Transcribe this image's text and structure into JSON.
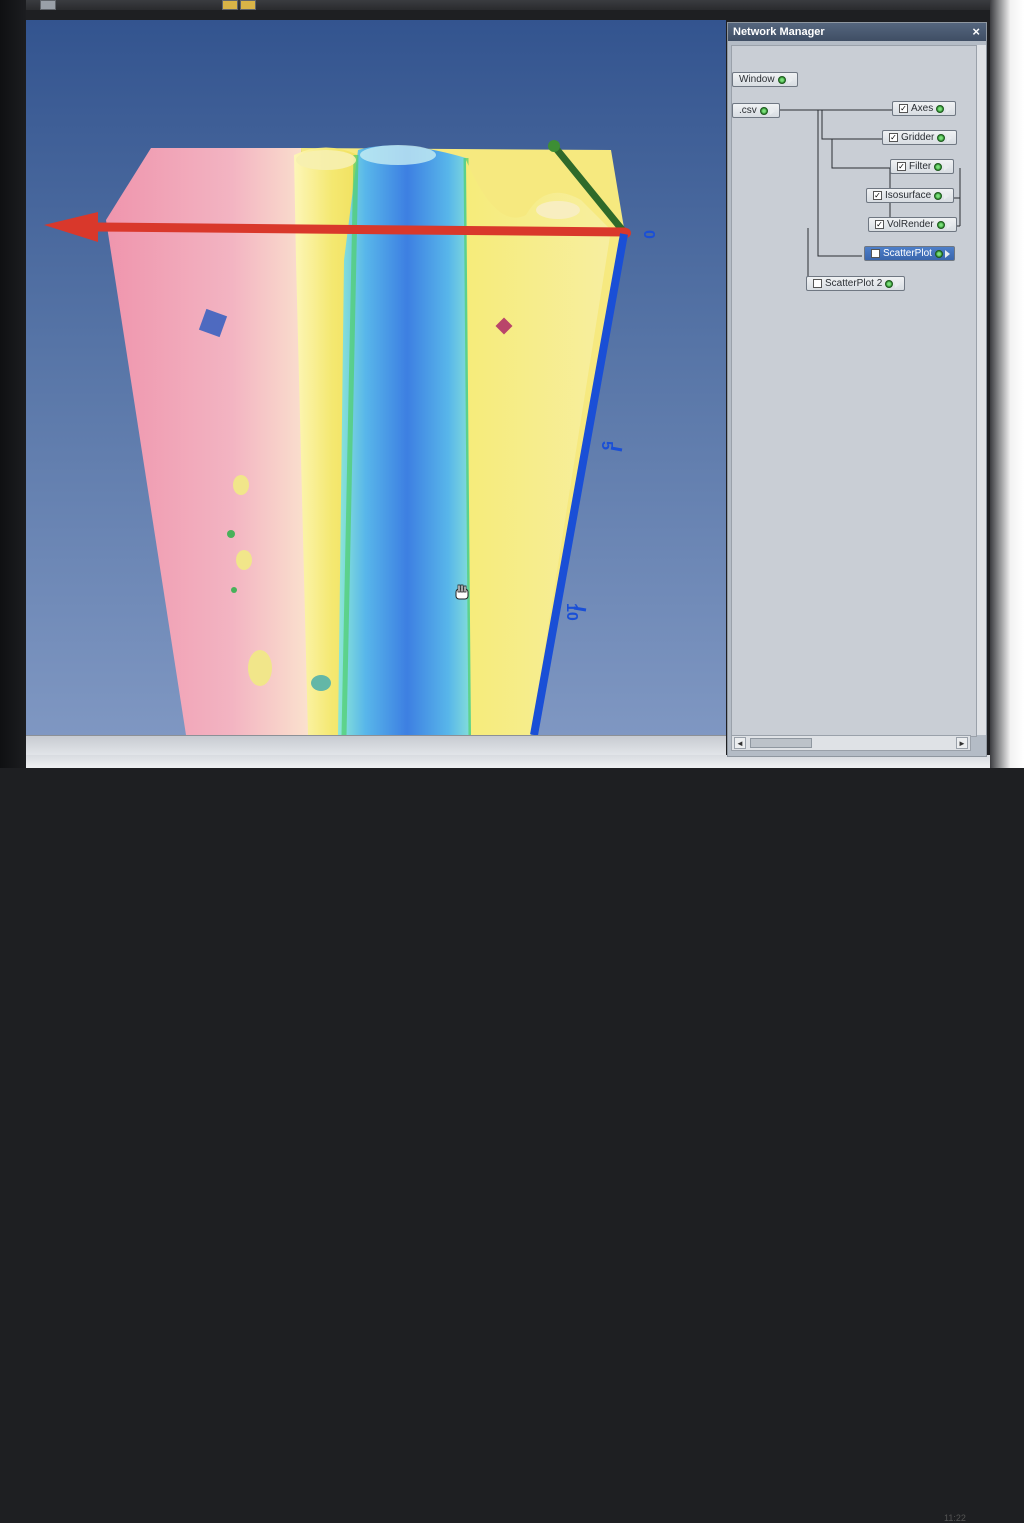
{
  "panel": {
    "title": "Network Manager",
    "close_glyph": "×",
    "modules": [
      {
        "id": "window",
        "label": "Window",
        "checkbox": false,
        "selected": false
      },
      {
        "id": "csv",
        "label": ".csv",
        "checkbox": false,
        "selected": false
      },
      {
        "id": "axes",
        "label": "Axes",
        "checkbox": true,
        "checked": true,
        "selected": false
      },
      {
        "id": "gridder",
        "label": "Gridder",
        "checkbox": true,
        "checked": true,
        "selected": false
      },
      {
        "id": "filter",
        "label": "Filter",
        "checkbox": true,
        "checked": true,
        "selected": false
      },
      {
        "id": "isosurface",
        "label": "Isosurface",
        "checkbox": true,
        "checked": true,
        "selected": false
      },
      {
        "id": "volrender",
        "label": "VolRender",
        "checkbox": true,
        "checked": true,
        "selected": false
      },
      {
        "id": "scatterplot",
        "label": "ScatterPlot",
        "checkbox": true,
        "checked": false,
        "selected": true
      },
      {
        "id": "scatterplot2",
        "label": "ScatterPlot 2",
        "checkbox": true,
        "checked": false,
        "selected": false
      }
    ],
    "check_glyph": "✓"
  },
  "viewport": {
    "axis_labels": [
      "0",
      "5",
      "10"
    ],
    "colors": {
      "background_top": "#33548f",
      "background_bottom": "#7f97c2",
      "x_axis": "#d9382b",
      "y_axis": "#2f6a2a",
      "z_axis": "#1a4fd6",
      "pink_volume": "#f0a0b4",
      "yellow_surface": "#f3ea7c",
      "blue_surface": "#3f7fe0",
      "cyan_surface": "#6fe3d8"
    }
  },
  "status": {
    "clock": "11:22"
  }
}
